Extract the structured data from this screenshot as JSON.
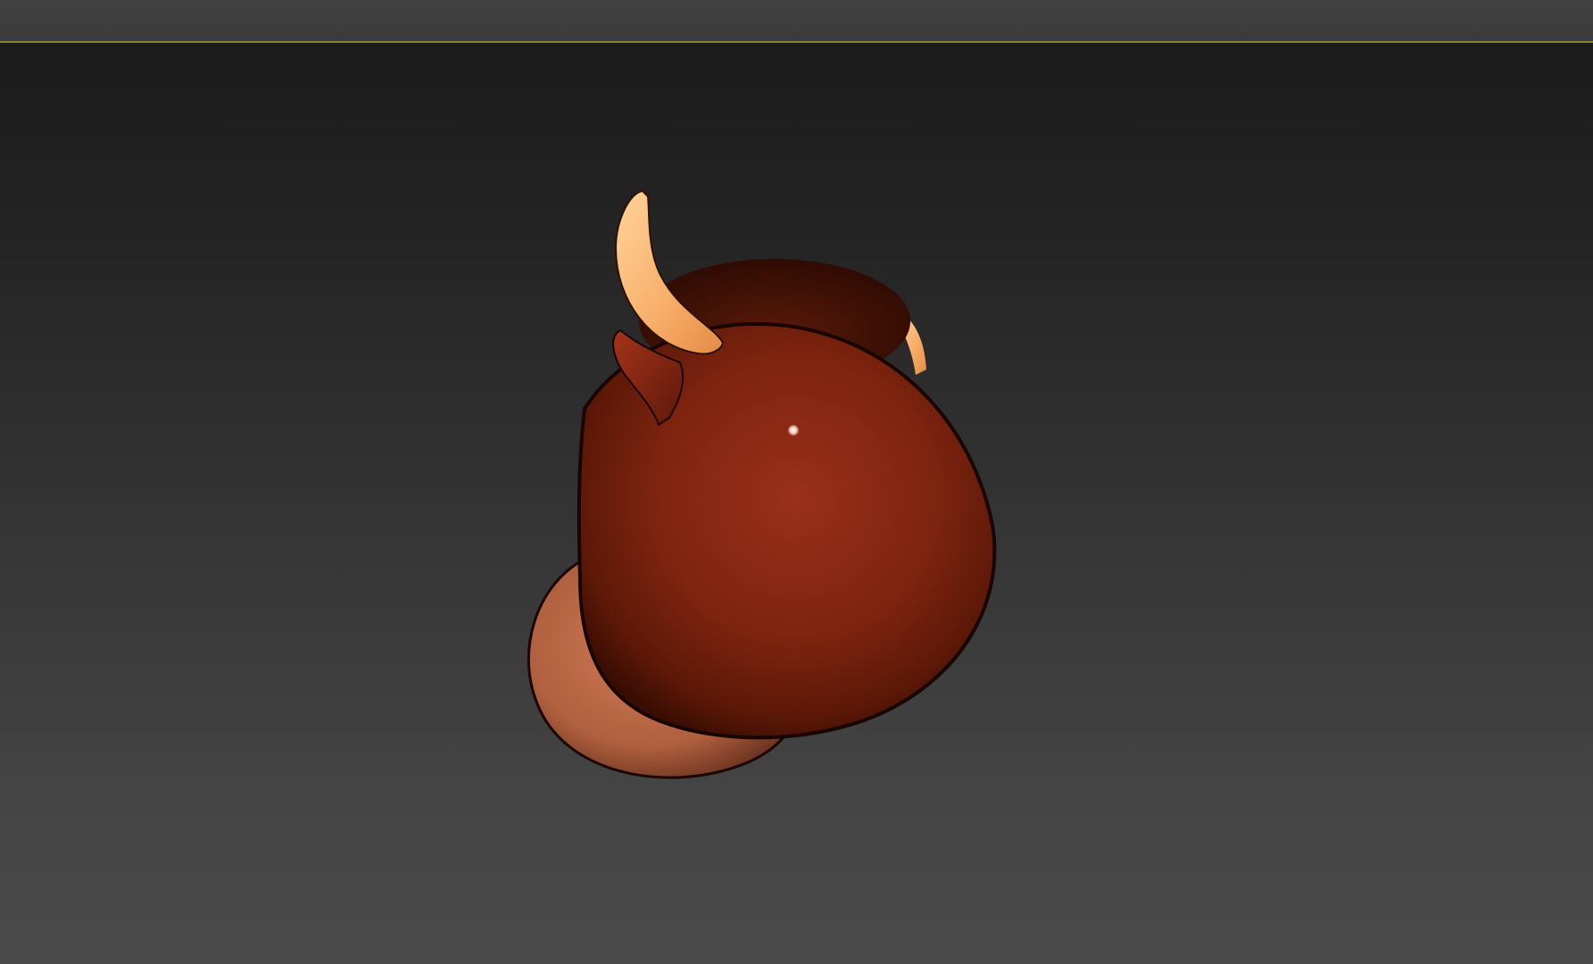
{
  "viewport": {
    "object_name": "bull-head-model",
    "colors": {
      "background_top": "#1b1b1b",
      "background_bottom": "#4a4a4a",
      "active_border": "#8a7f3a",
      "head": "#8a2a14",
      "head_shadow": "#4a0f05",
      "horn": "#f3a765",
      "muzzle": "#c4714f"
    },
    "icons": {
      "specular_highlight": "specular-dot"
    }
  }
}
